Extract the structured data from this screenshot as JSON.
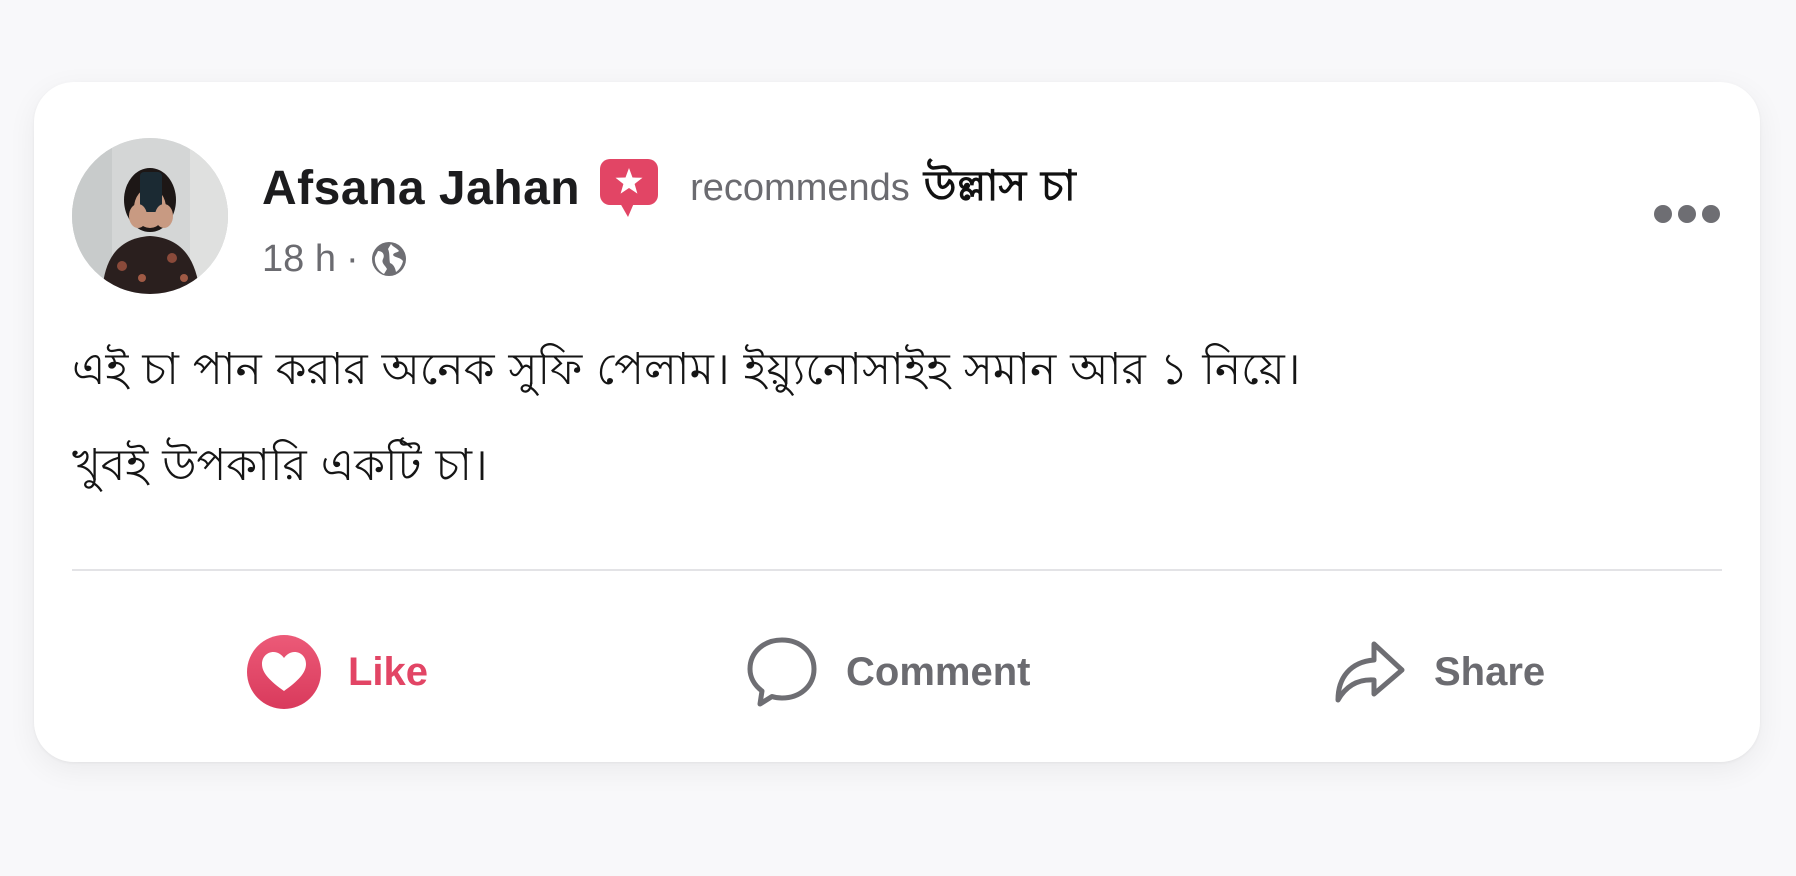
{
  "post": {
    "author_name": "Afsana Jahan",
    "recommends_word": "recommends",
    "page_name": "উল্লাস চা",
    "time": "18 h",
    "separator": "·",
    "privacy_icon": "globe-icon",
    "badge_icon": "star-speech-bubble-icon",
    "body_lines": [
      "এই চা পান করার অনেক সুফি পেলাম। ইয়্যুনোসাইহ সমান আর ১ নিয়ে।",
      "খুবই উপকারি একটি চা।"
    ]
  },
  "actions": {
    "like_label": "Like",
    "comment_label": "Comment",
    "share_label": "Share"
  },
  "colors": {
    "like_accent": "#e24565",
    "badge": "#e24565",
    "muted_text": "#6b6b70"
  }
}
